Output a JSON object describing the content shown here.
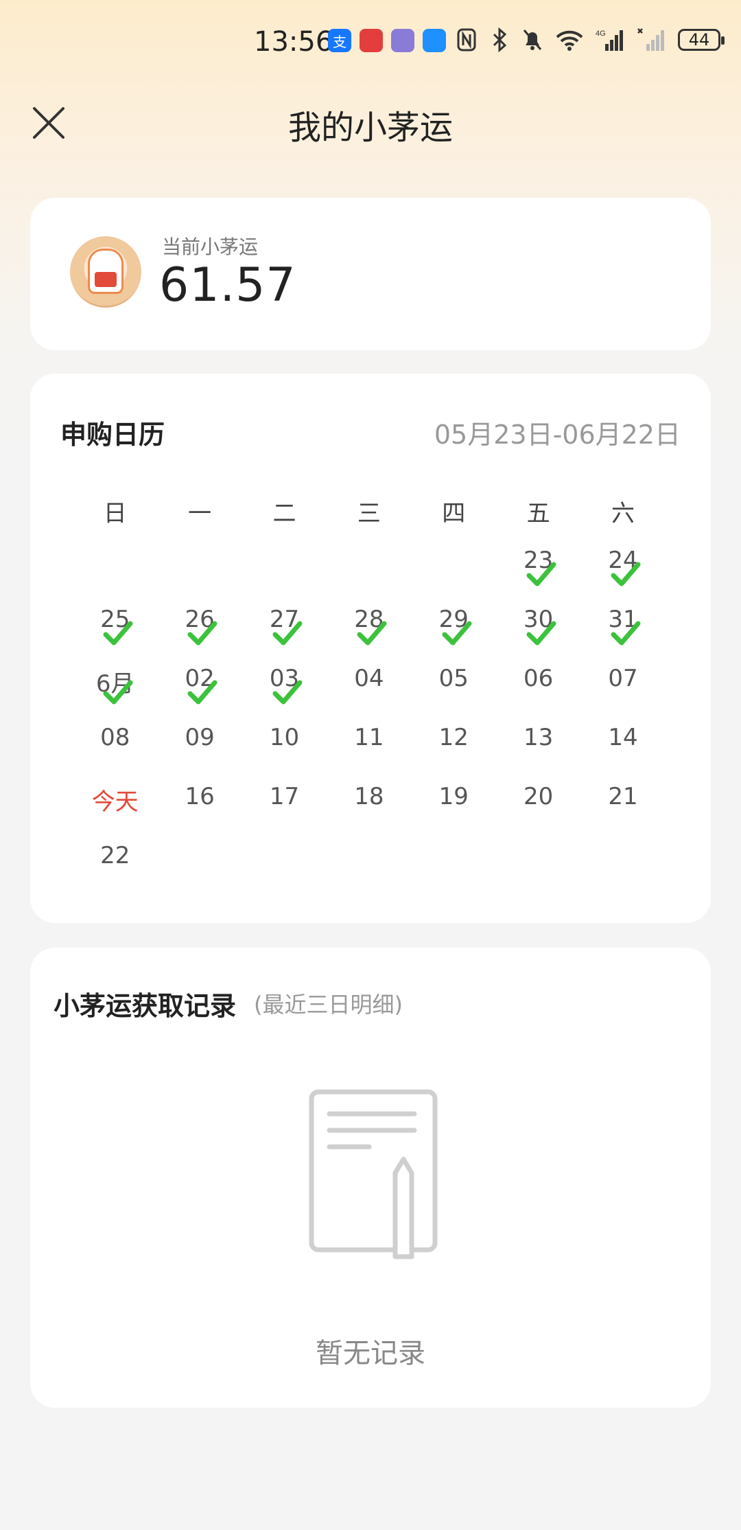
{
  "status_bar": {
    "time": "13:56",
    "battery": "44",
    "app_icons": [
      {
        "name": "alipay-icon",
        "color": "#1677ff",
        "glyph": "支"
      },
      {
        "name": "shopping-app-icon",
        "color": "#e43d3d",
        "glyph": ""
      },
      {
        "name": "camera-app-icon",
        "color": "#8a7bd8",
        "glyph": ""
      },
      {
        "name": "browser-app-icon",
        "color": "#1e90ff",
        "glyph": ""
      }
    ]
  },
  "nav": {
    "title": "我的小茅运"
  },
  "luck": {
    "label": "当前小茅运",
    "value": "61.57"
  },
  "calendar": {
    "title": "申购日历",
    "range": "05月23日-06月22日",
    "weekdays": [
      "日",
      "一",
      "二",
      "三",
      "四",
      "五",
      "六"
    ],
    "check_color": "#3cc23c",
    "today_color": "#e24a3a",
    "weeks": [
      [
        {
          "label": ""
        },
        {
          "label": ""
        },
        {
          "label": ""
        },
        {
          "label": ""
        },
        {
          "label": ""
        },
        {
          "label": "23",
          "checked": true
        },
        {
          "label": "24",
          "checked": true
        }
      ],
      [
        {
          "label": "25",
          "checked": true
        },
        {
          "label": "26",
          "checked": true
        },
        {
          "label": "27",
          "checked": true
        },
        {
          "label": "28",
          "checked": true
        },
        {
          "label": "29",
          "checked": true
        },
        {
          "label": "30",
          "checked": true
        },
        {
          "label": "31",
          "checked": true
        }
      ],
      [
        {
          "label": "6月",
          "checked": true
        },
        {
          "label": "02",
          "checked": true
        },
        {
          "label": "03",
          "checked": true
        },
        {
          "label": "04"
        },
        {
          "label": "05"
        },
        {
          "label": "06"
        },
        {
          "label": "07"
        }
      ],
      [
        {
          "label": "08"
        },
        {
          "label": "09"
        },
        {
          "label": "10"
        },
        {
          "label": "11"
        },
        {
          "label": "12"
        },
        {
          "label": "13"
        },
        {
          "label": "14"
        }
      ],
      [
        {
          "label": "今天",
          "today": true
        },
        {
          "label": "16"
        },
        {
          "label": "17"
        },
        {
          "label": "18"
        },
        {
          "label": "19"
        },
        {
          "label": "20"
        },
        {
          "label": "21"
        }
      ],
      [
        {
          "label": "22"
        },
        {
          "label": ""
        },
        {
          "label": ""
        },
        {
          "label": ""
        },
        {
          "label": ""
        },
        {
          "label": ""
        },
        {
          "label": ""
        }
      ]
    ]
  },
  "records": {
    "title": "小茅运获取记录",
    "subtitle": "(最近三日明细)",
    "empty_text": "暂无记录"
  }
}
